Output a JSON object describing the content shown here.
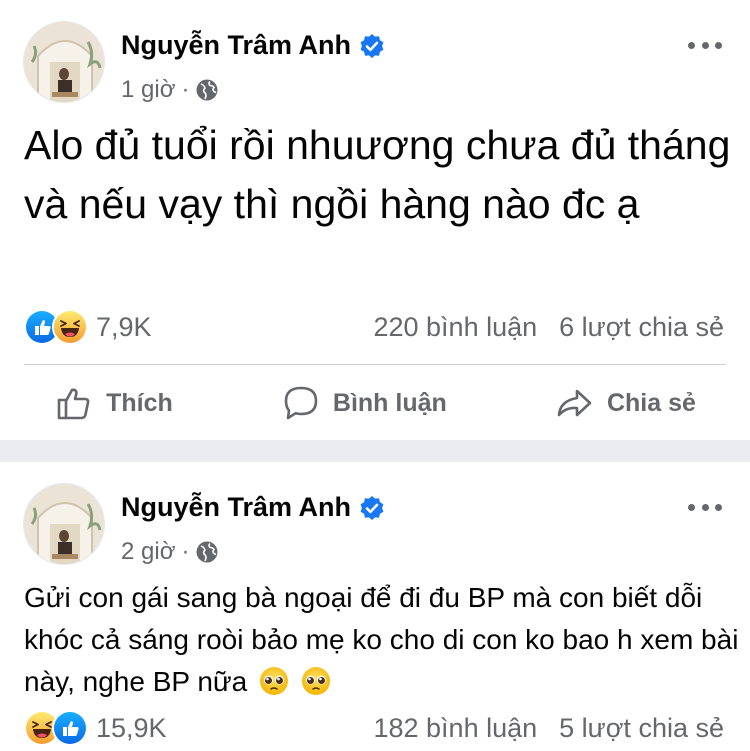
{
  "posts": [
    {
      "author": "Nguyễn Trâm Anh",
      "time": "1 giờ",
      "separator": "·",
      "text": "Alo đủ tuổi rồi nhuương chưa đủ tháng và nếu vạy thì ngồi hàng nào đc ạ",
      "reaction_count": "7,9K",
      "comments": "220 bình luận",
      "shares": "6 lượt chia sẻ",
      "actions": {
        "like": "Thích",
        "comment": "Bình luận",
        "share": "Chia sẻ"
      }
    },
    {
      "author": "Nguyễn Trâm Anh",
      "time": "2 giờ",
      "separator": "·",
      "text": "Gửi con gái sang bà ngoại để đi đu BP mà con biết dỗi khóc cả sáng roòi bảo mẹ ko cho di con ko bao h xem bài này, nghe BP nữa",
      "reaction_count": "15,9K",
      "comments": "182 bình luận",
      "shares": "5 lượt chia sẻ"
    }
  ],
  "colors": {
    "brand_blue": "#1877f2",
    "secondary_text": "#65676b",
    "divider": "#ebecef"
  },
  "icons": [
    "avatar",
    "verified-badge-icon",
    "globe-icon",
    "more-options-icon",
    "like-reaction-icon",
    "haha-reaction-icon",
    "like-outline-icon",
    "comment-outline-icon",
    "share-outline-icon",
    "pleading-face-emoji"
  ]
}
